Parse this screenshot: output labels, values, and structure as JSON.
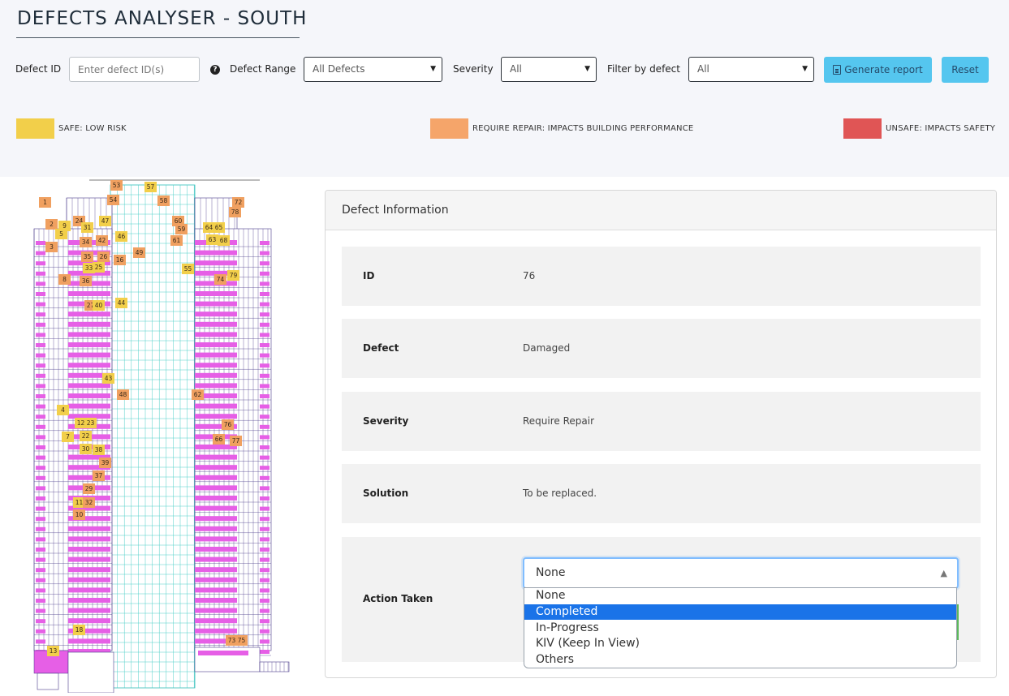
{
  "header": {
    "title": "DEFECTS ANALYSER - SOUTH"
  },
  "filters": {
    "defect_id_label": "Defect ID",
    "defect_id_placeholder": "Enter defect ID(s)",
    "defect_range_label": "Defect Range",
    "defect_range_value": "All Defects",
    "severity_label": "Severity",
    "severity_value": "All",
    "filter_label": "Filter by defect",
    "filter_value": "All",
    "generate_label": "Generate report",
    "reset_label": "Reset"
  },
  "legend": [
    {
      "label": "SAFE:  LOW RISK",
      "color": "#f2cf4a"
    },
    {
      "label": "REQUIRE REPAIR:  IMPACTS BUILDING PERFORMANCE",
      "color": "#f5a56a"
    },
    {
      "label": "UNSAFE:  IMPACTS SAFETY",
      "color": "#e05555"
    }
  ],
  "markers": [
    {
      "id": "1",
      "s": "o"
    },
    {
      "id": "2",
      "s": "o"
    },
    {
      "id": "3",
      "s": "o"
    },
    {
      "id": "4",
      "s": "y"
    },
    {
      "id": "5",
      "s": "y"
    },
    {
      "id": "7",
      "s": "y"
    },
    {
      "id": "8",
      "s": "o"
    },
    {
      "id": "9",
      "s": "y"
    },
    {
      "id": "10",
      "s": "o"
    },
    {
      "id": "11",
      "s": "y"
    },
    {
      "id": "12",
      "s": "y"
    },
    {
      "id": "13",
      "s": "y"
    },
    {
      "id": "16",
      "s": "o"
    },
    {
      "id": "18",
      "s": "y"
    },
    {
      "id": "22",
      "s": "y"
    },
    {
      "id": "23",
      "s": "y"
    },
    {
      "id": "24",
      "s": "o"
    },
    {
      "id": "25",
      "s": "y"
    },
    {
      "id": "26",
      "s": "o"
    },
    {
      "id": "27",
      "s": "o"
    },
    {
      "id": "29",
      "s": "o"
    },
    {
      "id": "30",
      "s": "y"
    },
    {
      "id": "31",
      "s": "y"
    },
    {
      "id": "32",
      "s": "o"
    },
    {
      "id": "33",
      "s": "y"
    },
    {
      "id": "34",
      "s": "o"
    },
    {
      "id": "35",
      "s": "o"
    },
    {
      "id": "36",
      "s": "o"
    },
    {
      "id": "37",
      "s": "o"
    },
    {
      "id": "38",
      "s": "y"
    },
    {
      "id": "39",
      "s": "o"
    },
    {
      "id": "40",
      "s": "y"
    },
    {
      "id": "42",
      "s": "o"
    },
    {
      "id": "43",
      "s": "y"
    },
    {
      "id": "44",
      "s": "y"
    },
    {
      "id": "46",
      "s": "y"
    },
    {
      "id": "47",
      "s": "y"
    },
    {
      "id": "48",
      "s": "o"
    },
    {
      "id": "49",
      "s": "o"
    },
    {
      "id": "53",
      "s": "o"
    },
    {
      "id": "54",
      "s": "o"
    },
    {
      "id": "55",
      "s": "y"
    },
    {
      "id": "57",
      "s": "y"
    },
    {
      "id": "58",
      "s": "o"
    },
    {
      "id": "59",
      "s": "o"
    },
    {
      "id": "60",
      "s": "o"
    },
    {
      "id": "61",
      "s": "o"
    },
    {
      "id": "62",
      "s": "o"
    },
    {
      "id": "63",
      "s": "y"
    },
    {
      "id": "64",
      "s": "y"
    },
    {
      "id": "65",
      "s": "y"
    },
    {
      "id": "66",
      "s": "o"
    },
    {
      "id": "68",
      "s": "y"
    },
    {
      "id": "72",
      "s": "o"
    },
    {
      "id": "73",
      "s": "o"
    },
    {
      "id": "74",
      "s": "o"
    },
    {
      "id": "75",
      "s": "o"
    },
    {
      "id": "76",
      "s": "o"
    },
    {
      "id": "77",
      "s": "o"
    },
    {
      "id": "78",
      "s": "o"
    },
    {
      "id": "79",
      "s": "y"
    }
  ],
  "info": {
    "title": "Defect Information",
    "id_label": "ID",
    "id_value": "76",
    "defect_label": "Defect",
    "defect_value": "Damaged",
    "severity_label": "Severity",
    "severity_value": "Require Repair",
    "solution_label": "Solution",
    "solution_value": "To be replaced.",
    "action_label": "Action Taken",
    "action_value": "None",
    "action_options": [
      "None",
      "Completed",
      "In-Progress",
      "KIV (Keep In View)",
      "Others"
    ],
    "highlighted_option": "Completed"
  }
}
